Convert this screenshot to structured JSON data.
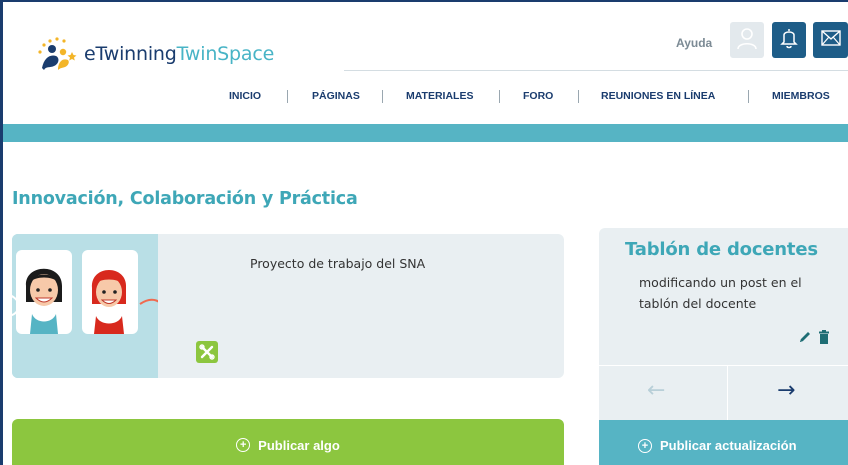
{
  "header": {
    "logo_text_1": "eTwinning",
    "logo_text_2": "TwinSpace",
    "help_label": "Ayuda",
    "icons": [
      "user-icon",
      "bell-icon",
      "mail-icon"
    ]
  },
  "nav": {
    "items": [
      "INICIO",
      "PÁGINAS",
      "MATERIALES",
      "FORO",
      "REUNIONES EN LÍNEA",
      "MIEMBROS"
    ]
  },
  "page": {
    "title": "Innovación, Colaboración y Práctica"
  },
  "project": {
    "description": "Proyecto de trabajo del SNA",
    "tools_icon": "tools-icon",
    "publish_label": "Publicar algo"
  },
  "board": {
    "title": "Tablón de docentes",
    "post_text": "modificando un post en el tablón del docente",
    "prev_arrow": "←",
    "next_arrow": "→",
    "publish_label": "Publicar actualización"
  },
  "colors": {
    "brand_dark": "#1a3c6e",
    "teal": "#56b4c4",
    "title_teal": "#3ea7b7",
    "green": "#8cc63f",
    "panel_bg": "#e9eff2"
  }
}
